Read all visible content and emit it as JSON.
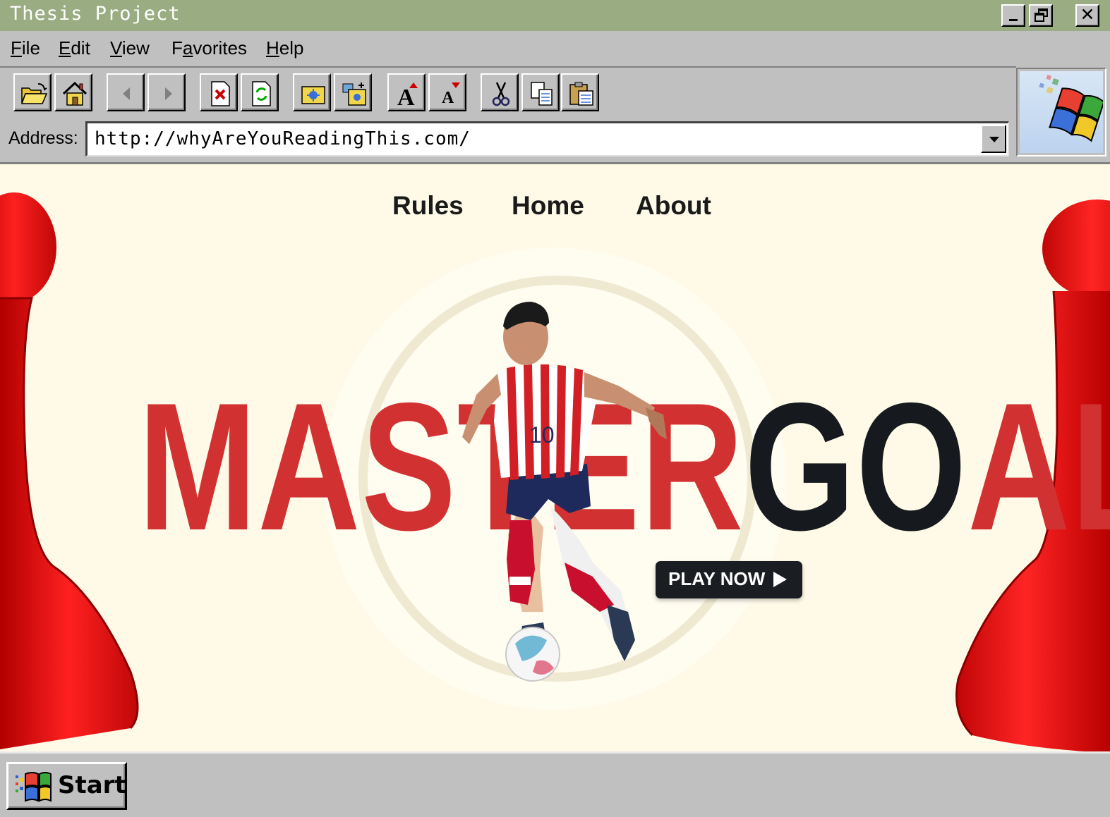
{
  "window": {
    "title": "Thesis Project",
    "controls": {
      "minimize": "minimize-icon",
      "restore": "restore-icon",
      "close": "✕"
    }
  },
  "menu": {
    "items": [
      {
        "label": "File",
        "accel": "F",
        "rest": "ile"
      },
      {
        "label": "Edit",
        "accel": "E",
        "rest": "dit"
      },
      {
        "label": "View",
        "accel": "V",
        "rest": "iew"
      },
      {
        "label": "Favorites",
        "accel": "a",
        "pre": "F",
        "rest": "vorites"
      },
      {
        "label": "Help",
        "accel": "H",
        "rest": "elp"
      }
    ]
  },
  "toolbar": {
    "buttons": [
      "open-folder-icon",
      "home-icon",
      "back-icon",
      "forward-icon",
      "stop-icon",
      "refresh-icon",
      "favorites-folder-icon",
      "add-favorite-icon",
      "font-larger-icon",
      "font-smaller-icon",
      "cut-icon",
      "copy-icon",
      "paste-icon"
    ]
  },
  "address": {
    "label": "Address:",
    "url": "http://whyAreYouReadingThis.com/"
  },
  "page": {
    "nav": [
      "Rules",
      "Home",
      "About"
    ],
    "hero": {
      "part_red": "MASTER",
      "part_dark": "GO",
      "part_red2": "AL"
    },
    "cta": "PLAY NOW",
    "colors": {
      "accent_red": "#d23131",
      "dark": "#161a1f",
      "background": "#fffae8"
    }
  },
  "taskbar": {
    "start_label": "Start"
  }
}
